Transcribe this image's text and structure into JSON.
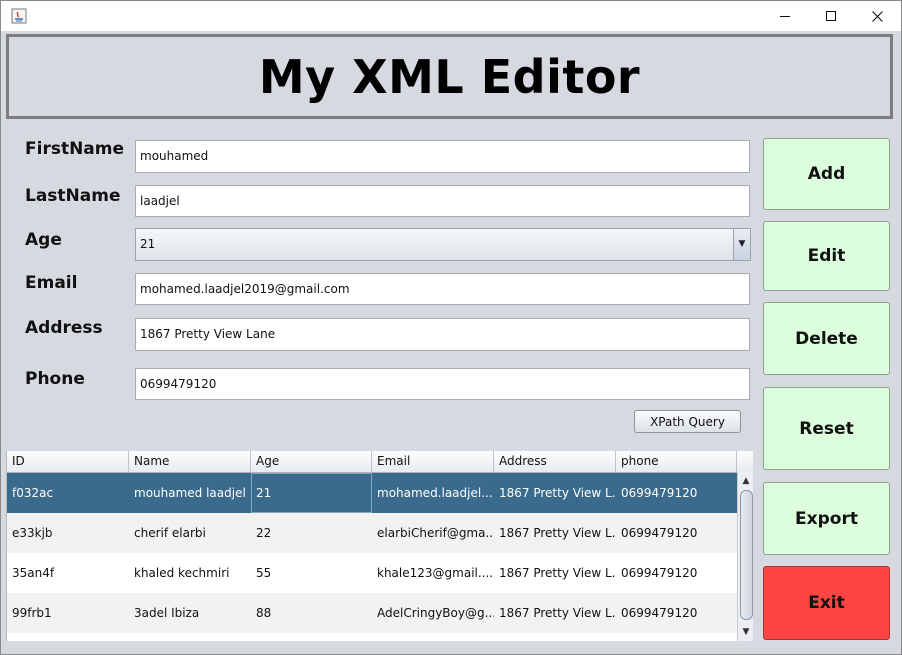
{
  "header": {
    "title": "My XML Editor"
  },
  "form": {
    "firstname_label": "FirstName",
    "firstname_value": "mouhamed",
    "lastname_label": "LastName",
    "lastname_value": "laadjel",
    "age_label": "Age",
    "age_value": "21",
    "email_label": "Email",
    "email_value": "mohamed.laadjel2019@gmail.com",
    "address_label": "Address",
    "address_value": "1867 Pretty View Lane",
    "phone_label": "Phone",
    "phone_value": "0699479120",
    "xpath_label": "XPath Query"
  },
  "buttons": {
    "add": "Add",
    "edit": "Edit",
    "delete": "Delete",
    "reset": "Reset",
    "export": "Export",
    "exit": "Exit"
  },
  "table": {
    "columns": [
      "ID",
      "Name",
      "Age",
      "Email",
      "Address",
      "phone"
    ],
    "rows": [
      [
        "f032ac",
        "mouhamed laadjel",
        "21",
        "mohamed.laadjel...",
        "1867 Pretty View L...",
        "0699479120"
      ],
      [
        "e33kjb",
        "cherif elarbi",
        "22",
        "elarbiCherif@gma...",
        "1867 Pretty View L...",
        "0699479120"
      ],
      [
        "35an4f",
        "khaled kechmiri",
        "55",
        "khale123@gmail....",
        "1867 Pretty View L...",
        "0699479120"
      ],
      [
        "99frb1",
        "3adel Ibiza",
        "88",
        "AdelCringyBoy@g...",
        "1867 Pretty View L...",
        "0699479120"
      ]
    ],
    "selected_row": 0
  },
  "colors": {
    "button_bg": "#ddfedd",
    "exit_bg": "#ff4444",
    "selection": "#3b6b8c",
    "panel_bg": "#d6d9df"
  }
}
